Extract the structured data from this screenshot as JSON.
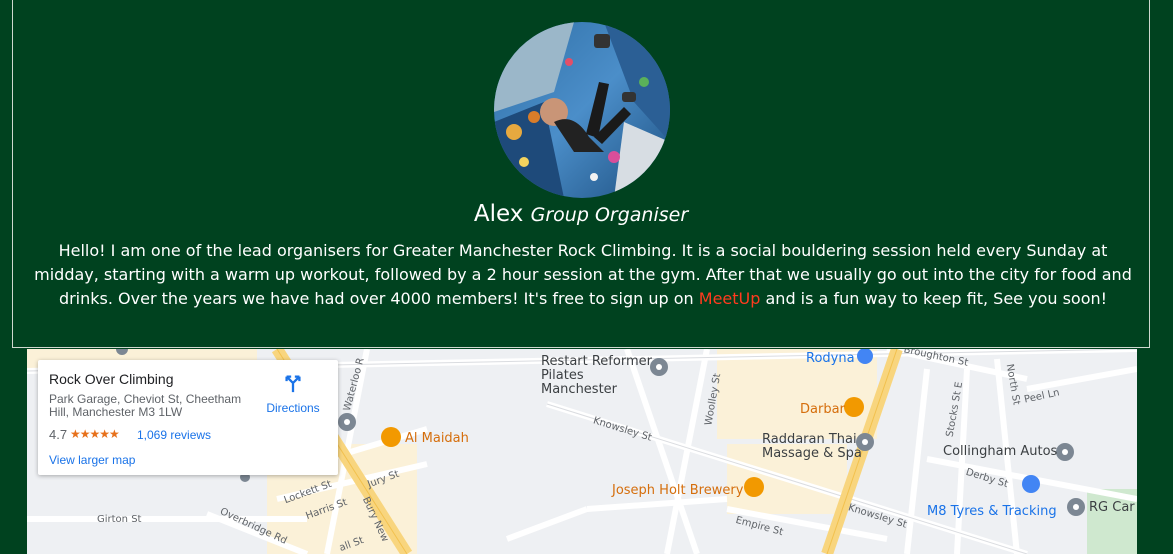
{
  "profile": {
    "name": "Alex",
    "role": "Group Organiser",
    "bio_before": "Hello! I am one of the lead organisers for Greater Manchester Rock Climbing. It is a social bouldering session held every Sunday at midday, starting with a warm up workout, followed by a 2 hour session at the gym. After that we usually go out into the city for food and drinks. Over the years we have had over 4000 members! It's free to sign up on ",
    "bio_link": "MeetUp",
    "bio_after": " and is a fun way to keep fit, See you soon!",
    "link_color": "#ff3b1f",
    "background_color": "#00421f"
  },
  "map": {
    "place_card": {
      "title": "Rock Over Climbing",
      "address": "Park Garage, Cheviot St, Cheetham Hill, Manchester M3 1LW",
      "rating": "4.7",
      "stars": "★★★★★",
      "reviews": "1,069 reviews",
      "directions_label": "Directions",
      "view_larger": "View larger map"
    },
    "pois": {
      "restart": "Restart Reformer Pilates Manchester",
      "rodyna": "Rodyna",
      "darbar": "Darbar",
      "al_maidah": "Al Maidah",
      "raddaran": "Raddaran Thai Massage & Spa",
      "joseph_holt": "Joseph Holt Brewery",
      "collingham": "Collingham Autos",
      "m8_tyres": "M8 Tyres & Tracking",
      "rg_car": "RG Car"
    },
    "streets": {
      "broughton": "Broughton St",
      "north_st": "North St",
      "peel_ln": "Peel Ln",
      "stocks_st_e": "Stocks St E",
      "woolley": "Woolley St",
      "waterloo": "Waterloo R",
      "knowsley_1": "Knowsley St",
      "knowsley_2": "Knowsley St",
      "derby": "Derby St",
      "jury": "Jury St",
      "lockett": "Lockett St",
      "harris": "Harris St",
      "bury_new": "Bury New",
      "girton": "Girton St",
      "overbridge": "Overbridge Rd",
      "empire": "Empire St",
      "hall_st": "all St"
    }
  }
}
